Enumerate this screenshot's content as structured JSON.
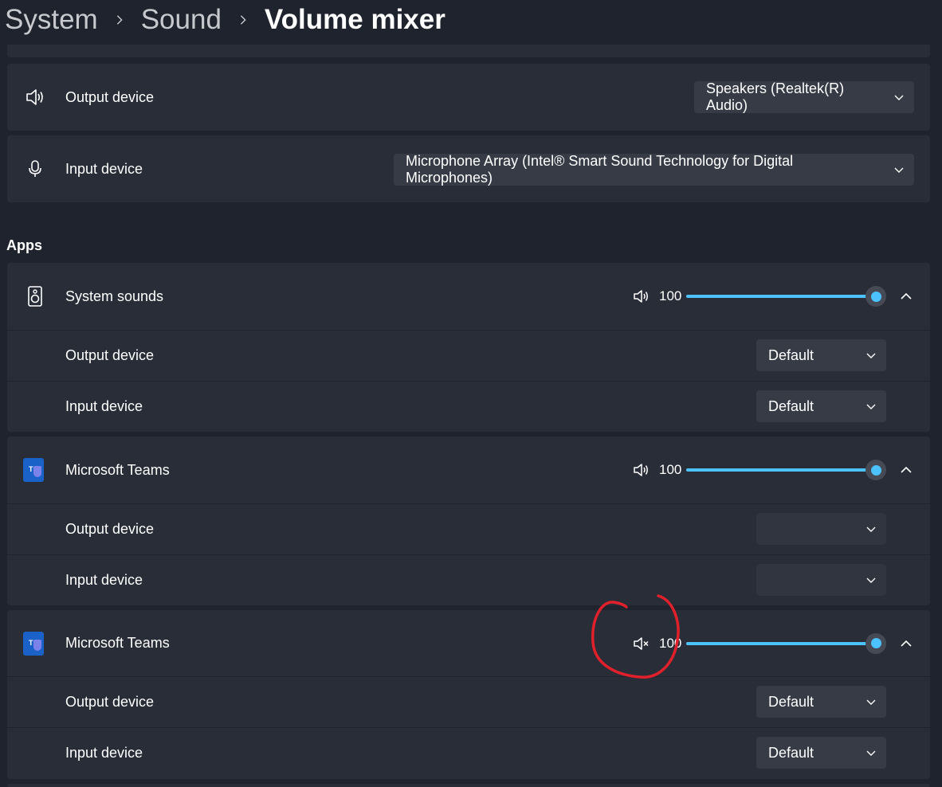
{
  "breadcrumb": {
    "items": [
      "System",
      "Sound"
    ],
    "current": "Volume mixer"
  },
  "devices": {
    "output": {
      "label": "Output device",
      "value": "Speakers (Realtek(R) Audio)"
    },
    "input": {
      "label": "Input device",
      "value": "Microphone Array (Intel® Smart Sound Technology for Digital Microphones)"
    }
  },
  "apps_title": "Apps",
  "apps": [
    {
      "name": "System sounds",
      "volume": "100",
      "volume_level": 1.0,
      "muted": false,
      "output_label": "Output device",
      "output_value": "Default",
      "input_label": "Input device",
      "input_value": "Default"
    },
    {
      "name": "Microsoft Teams",
      "volume": "100",
      "volume_level": 1.0,
      "muted": false,
      "output_label": "Output device",
      "output_value": "",
      "input_label": "Input device",
      "input_value": ""
    },
    {
      "name": "Microsoft Teams",
      "volume": "100",
      "volume_level": 1.0,
      "muted": true,
      "output_label": "Output device",
      "output_value": "Default",
      "input_label": "Input device",
      "input_value": "Default"
    }
  ],
  "colors": {
    "accent": "#4cc2ff",
    "background": "#1f232d",
    "card": "#292d38",
    "annotation": "#e0202a"
  }
}
